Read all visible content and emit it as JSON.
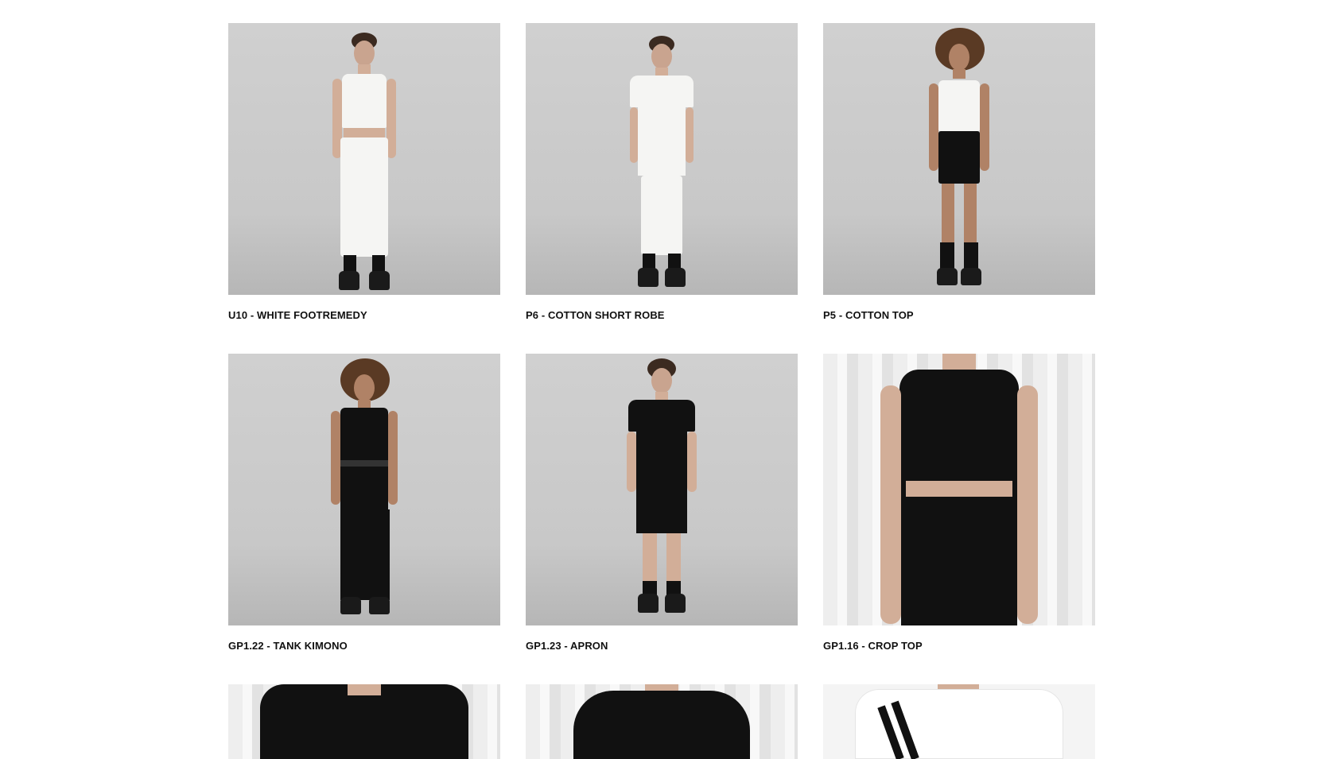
{
  "products": [
    {
      "title": "U10 - WHITE FOOTREMEDY",
      "image": "model-white-crop-tank-white-joggers"
    },
    {
      "title": "P6 - COTTON SHORT ROBE",
      "image": "model-white-tshirt-white-joggers"
    },
    {
      "title": "P5 - COTTON TOP",
      "image": "model-white-crop-tank-black-shorts"
    },
    {
      "title": "GP1.22 - TANK KIMONO",
      "image": "model-black-tank-kimono-wide-pants"
    },
    {
      "title": "GP1.23 - APRON",
      "image": "model-black-apron-shorts"
    },
    {
      "title": "GP1.16 - CROP TOP",
      "image": "black-linen-crop-top-closeup"
    },
    {
      "title": "",
      "image": "black-kimono-closeup"
    },
    {
      "title": "",
      "image": "black-linen-top-closeup"
    },
    {
      "title": "",
      "image": "white-turtleneck-strap-closeup"
    }
  ],
  "colors": {
    "text": "#111111",
    "background": "#ffffff"
  }
}
